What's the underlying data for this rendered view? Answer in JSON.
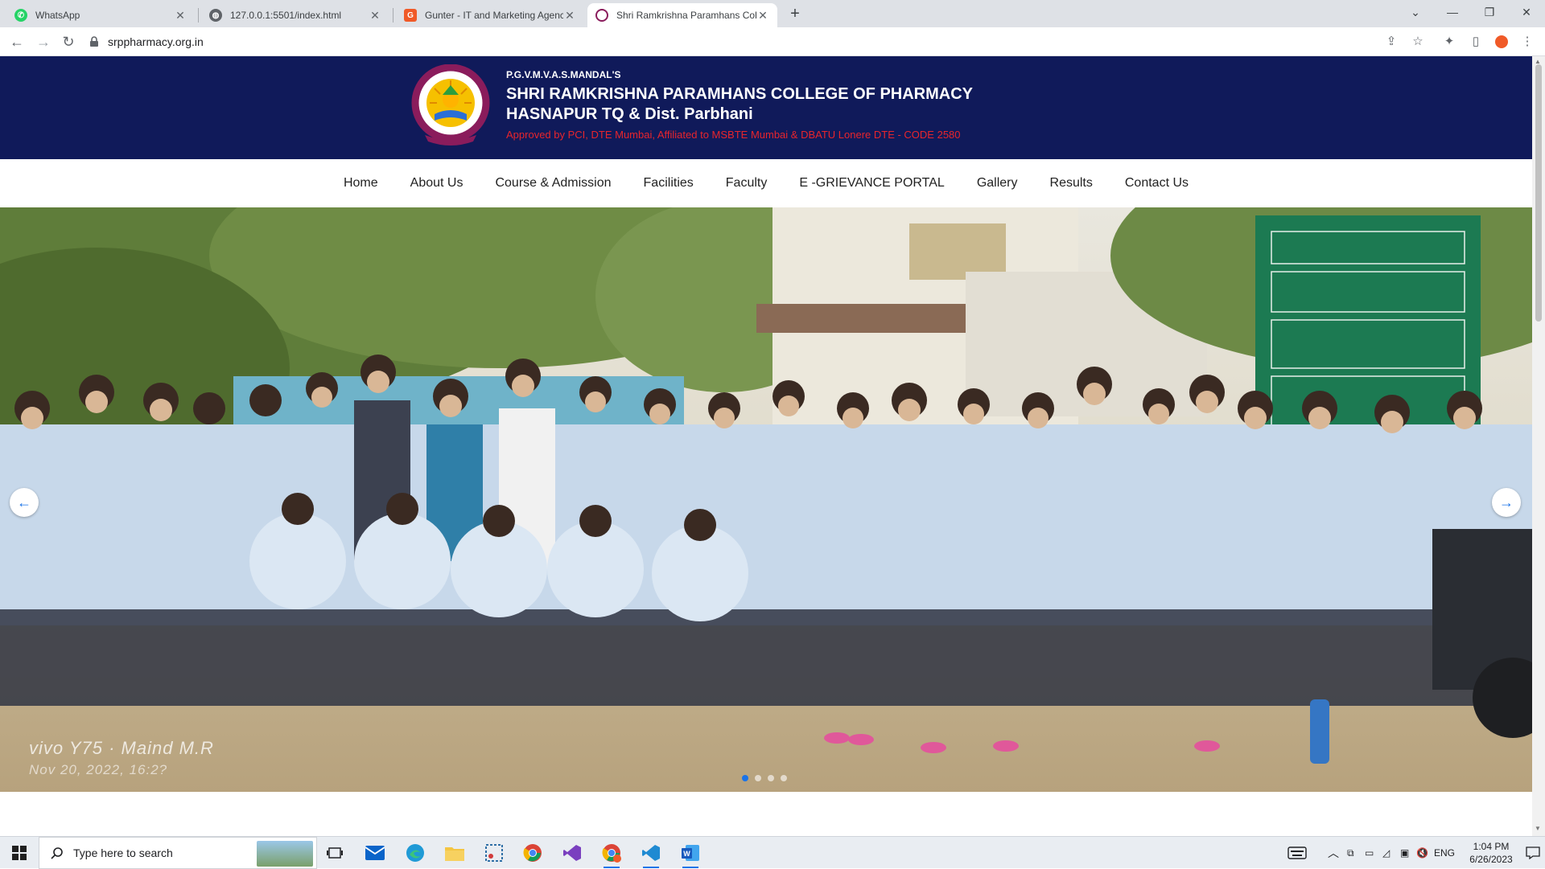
{
  "browser": {
    "tabs": [
      {
        "label": "WhatsApp",
        "icon": "whatsapp-icon",
        "color": "#25d366"
      },
      {
        "label": "127.0.0.1:5501/index.html",
        "icon": "globe-icon",
        "color": "#5f6368"
      },
      {
        "label": "Gunter - IT and Marketing Agenc",
        "icon": "gunter-icon",
        "color": "#f05a28"
      },
      {
        "label": "Shri Ramkrishna Paramhans Colle",
        "icon": "college-icon",
        "color": "#8a1c5c"
      }
    ],
    "active_tab": 3,
    "url": "srppharmacy.org.in"
  },
  "header": {
    "pre_title": "P.G.V.M.V.A.S.MANDAL'S",
    "name_line1": "SHRI RAMKRISHNA PARAMHANS COLLEGE OF PHARMACY",
    "name_line2": "HASNAPUR TQ & Dist. Parbhani",
    "approval": "Approved by PCI, DTE Mumbai, Affiliated to MSBTE Mumbai & DBATU Lonere DTE - CODE 2580",
    "colors": {
      "band": "#101a5a",
      "approval": "#e8252c"
    }
  },
  "nav": {
    "items": [
      "Home",
      "About Us",
      "Course & Admission",
      "Facilities",
      "Faculty",
      "E -GRIEVANCE PORTAL",
      "Gallery",
      "Results",
      "Contact Us"
    ]
  },
  "carousel": {
    "slide_count": 4,
    "active_slide": 0,
    "watermark_line1": "vivo Y75 · Maind M.R",
    "watermark_line2": "Nov 20, 2022, 16:2?",
    "prev_icon": "arrow-left-icon",
    "next_icon": "arrow-right-icon"
  },
  "taskbar": {
    "search_placeholder": "Type here to search",
    "time": "1:04 PM",
    "date": "6/26/2023",
    "language": "ENG"
  }
}
